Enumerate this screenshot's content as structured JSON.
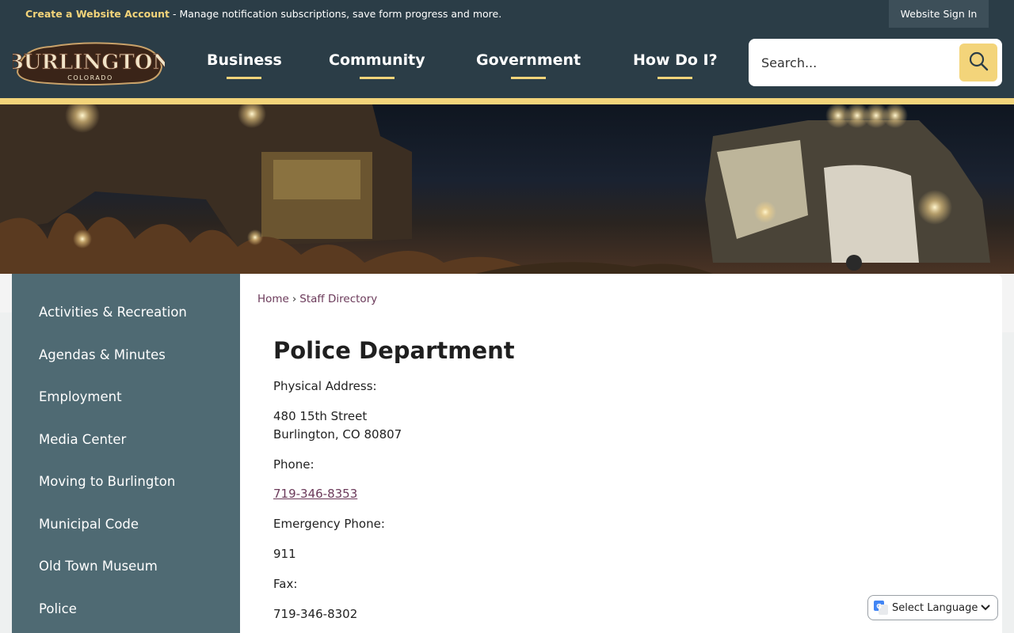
{
  "topbar": {
    "create_account_link": "Create a Website Account",
    "message": " - Manage notification subscriptions, save form progress and more.",
    "signin_label": "Website Sign In"
  },
  "logo": {
    "title": "BURLINGTON",
    "subtitle": "COLORADO"
  },
  "nav": {
    "items": [
      {
        "label": "Business"
      },
      {
        "label": "Community"
      },
      {
        "label": "Government"
      },
      {
        "label": "How Do I?"
      }
    ]
  },
  "search": {
    "placeholder": "Search..."
  },
  "sidebar": {
    "items": [
      {
        "label": "Activities & Recreation"
      },
      {
        "label": "Agendas & Minutes"
      },
      {
        "label": "Employment"
      },
      {
        "label": "Media Center"
      },
      {
        "label": "Moving to Burlington"
      },
      {
        "label": "Municipal Code"
      },
      {
        "label": "Old Town Museum"
      },
      {
        "label": "Police"
      }
    ]
  },
  "breadcrumb": {
    "home": "Home",
    "separator": "›",
    "current": "Staff Directory"
  },
  "department": {
    "title": "Police Department",
    "physical_address_label": "Physical Address:",
    "address_line1": "480 15th Street",
    "address_line2": "Burlington, CO 80807",
    "phone_label": "Phone:",
    "phone": "719-346-8353",
    "emergency_label": "Emergency Phone:",
    "emergency": "911",
    "fax_label": "Fax:",
    "fax": "719-346-8302"
  },
  "translate": {
    "label": "Select Language"
  },
  "colors": {
    "header": "#2b3d47",
    "accent": "#f3d47a",
    "sidebar": "#4f6a73",
    "link": "#6b3a5a"
  }
}
